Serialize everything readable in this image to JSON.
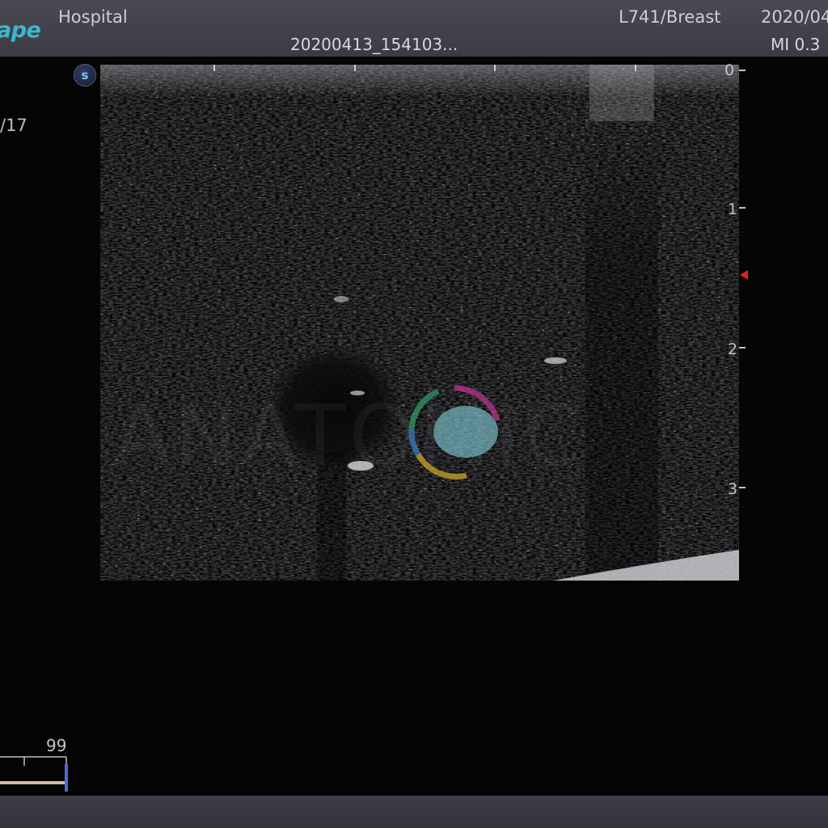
{
  "header": {
    "brand": "ape",
    "hospital": "Hospital",
    "study_id": "20200413_154103...",
    "probe_preset": "L741/Breast",
    "date": "2020/04",
    "mi": "MI 0.3"
  },
  "left_panel": {
    "frame_number": "/17",
    "gray_value": "99"
  },
  "image": {
    "logo_letter": "s",
    "watermark": "ANATOMIC",
    "depth_labels": [
      "0",
      "1",
      "2",
      "3"
    ]
  },
  "colors": {
    "brand": "#3fb7cc",
    "focus_marker": "#e21d20",
    "header_bg": "#3b3a45"
  }
}
